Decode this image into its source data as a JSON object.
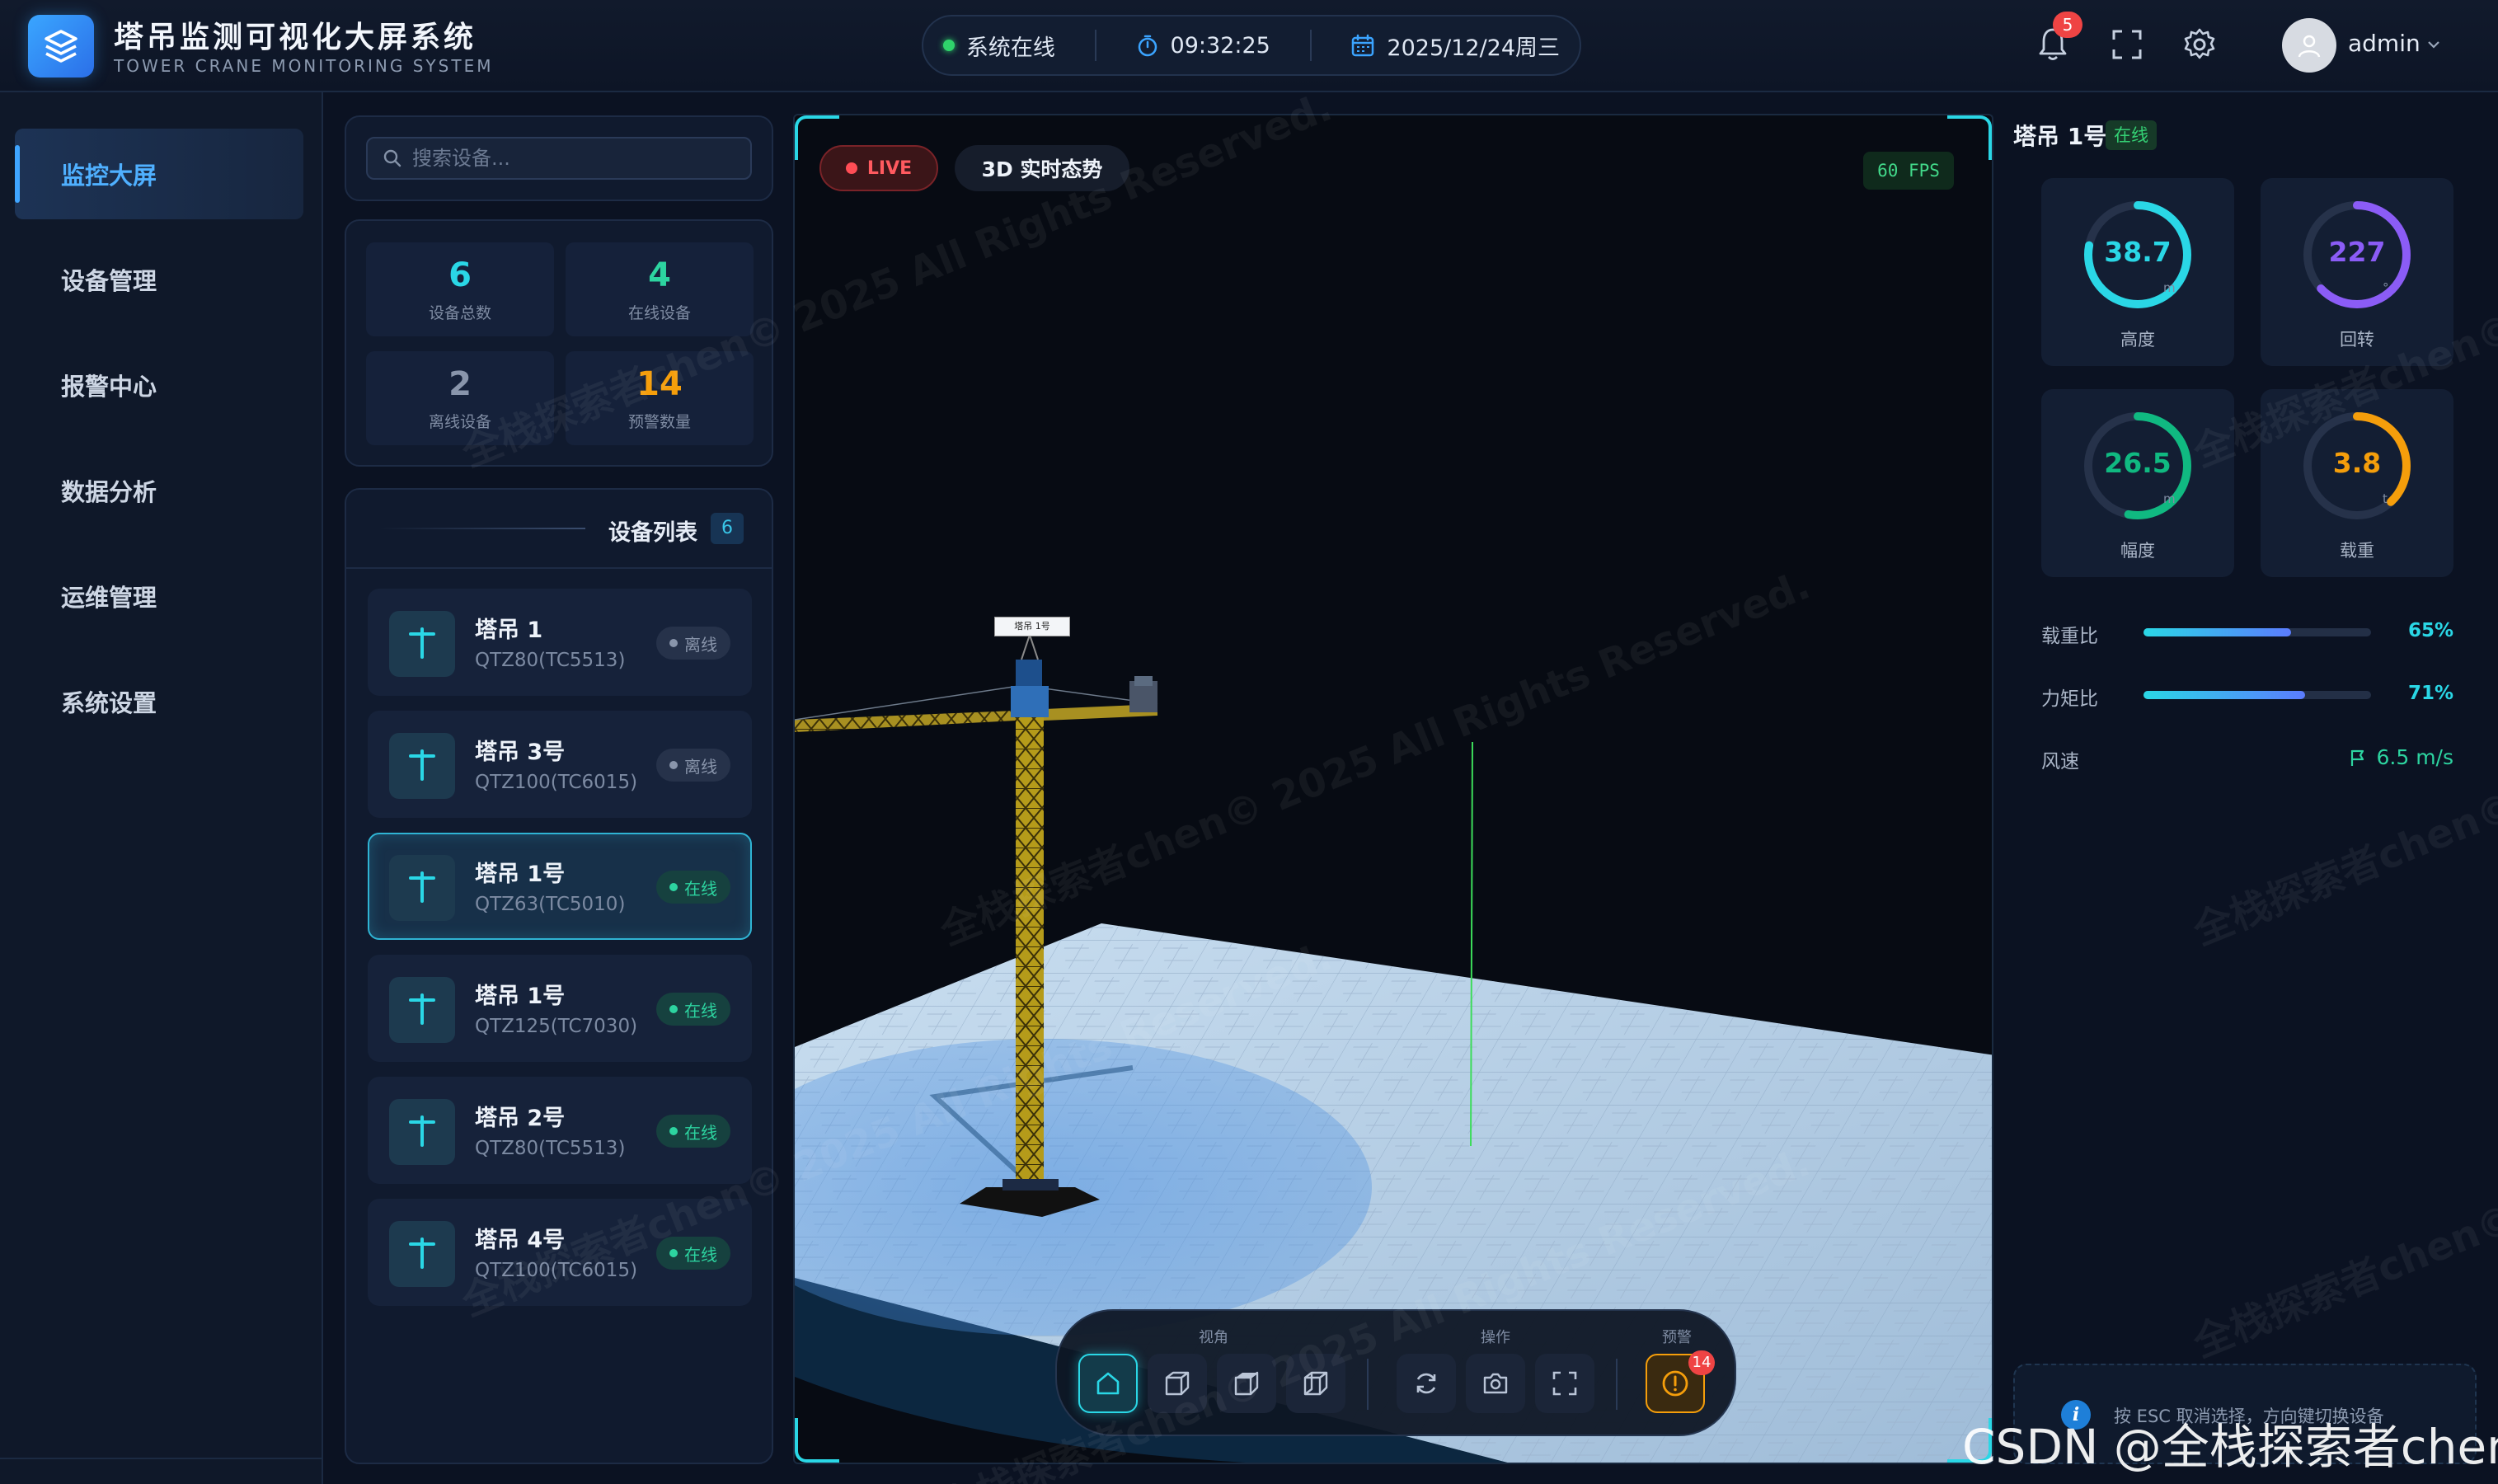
{
  "header": {
    "title": "塔吊监测可视化大屏系统",
    "subtitle": "TOWER CRANE MONITORING SYSTEM",
    "system_status": "系统在线",
    "time": "09:32:25",
    "date": "2025/12/24周三",
    "notification_count": "5",
    "username": "admin"
  },
  "sidebar": {
    "items": [
      {
        "label": "监控大屏",
        "active": true
      },
      {
        "label": "设备管理"
      },
      {
        "label": "报警中心"
      },
      {
        "label": "数据分析"
      },
      {
        "label": "运维管理"
      },
      {
        "label": "系统设置"
      }
    ]
  },
  "search": {
    "placeholder": "搜索设备..."
  },
  "stats": {
    "total": {
      "value": "6",
      "label": "设备总数",
      "color": "#2ad7e6"
    },
    "online": {
      "value": "4",
      "label": "在线设备",
      "color": "#2dd4a0"
    },
    "offline": {
      "value": "2",
      "label": "离线设备",
      "color": "#8995ab"
    },
    "warnings": {
      "value": "14",
      "label": "预警数量",
      "color": "#f59e0b"
    }
  },
  "device_list": {
    "title": "设备列表",
    "count": "6",
    "items": [
      {
        "name": "塔吊 1",
        "model": "QTZ80(TC5513)",
        "status": "离线",
        "state": "offline"
      },
      {
        "name": "塔吊 3号",
        "model": "QTZ100(TC6015)",
        "status": "离线",
        "state": "offline"
      },
      {
        "name": "塔吊 1号",
        "model": "QTZ63(TC5010)",
        "status": "在线",
        "state": "online",
        "selected": true
      },
      {
        "name": "塔吊 1号",
        "model": "QTZ125(TC7030)",
        "status": "在线",
        "state": "online"
      },
      {
        "name": "塔吊 2号",
        "model": "QTZ80(TC5513)",
        "status": "在线",
        "state": "online"
      },
      {
        "name": "塔吊 4号",
        "model": "QTZ100(TC6015)",
        "status": "在线",
        "state": "online"
      }
    ]
  },
  "viewport": {
    "live_label": "LIVE",
    "title": "3D 实时态势",
    "fps": "60 FPS",
    "crane_tag": "塔吊 1号",
    "toolbar": {
      "view_label": "视角",
      "ops_label": "操作",
      "alert_label": "预警",
      "alert_count": "14"
    }
  },
  "detail": {
    "name": "塔吊 1号",
    "status": "在线",
    "gauges": [
      {
        "value": "38.7",
        "unit": "m",
        "label": "高度",
        "fraction": 0.78,
        "color": "#2ad7e6"
      },
      {
        "value": "227",
        "unit": "°",
        "label": "回转",
        "fraction": 0.63,
        "color": "#8b5cf6"
      },
      {
        "value": "26.5",
        "unit": "m",
        "label": "幅度",
        "fraction": 0.53,
        "color": "#10b981"
      },
      {
        "value": "3.8",
        "unit": "t",
        "label": "载重",
        "fraction": 0.38,
        "color": "#f59e0b"
      }
    ],
    "load_ratio": {
      "label": "载重比",
      "value": "65%",
      "fraction": 0.65
    },
    "moment_ratio": {
      "label": "力矩比",
      "value": "71%",
      "fraction": 0.71
    },
    "wind": {
      "label": "风速",
      "value": "6.5 m/s"
    }
  },
  "hint": "按 ESC 取消选择，方向键切换设备",
  "watermark": "全栈探索者chen© 2025 All Rights Reserved.",
  "csdn_mark": "CSDN @全栈探索者chen",
  "colors": {
    "accent": "#2ad7e6",
    "online": "#2dd4a0",
    "offline": "#8995ab",
    "warning": "#f59e0b",
    "danger": "#ef4444"
  }
}
